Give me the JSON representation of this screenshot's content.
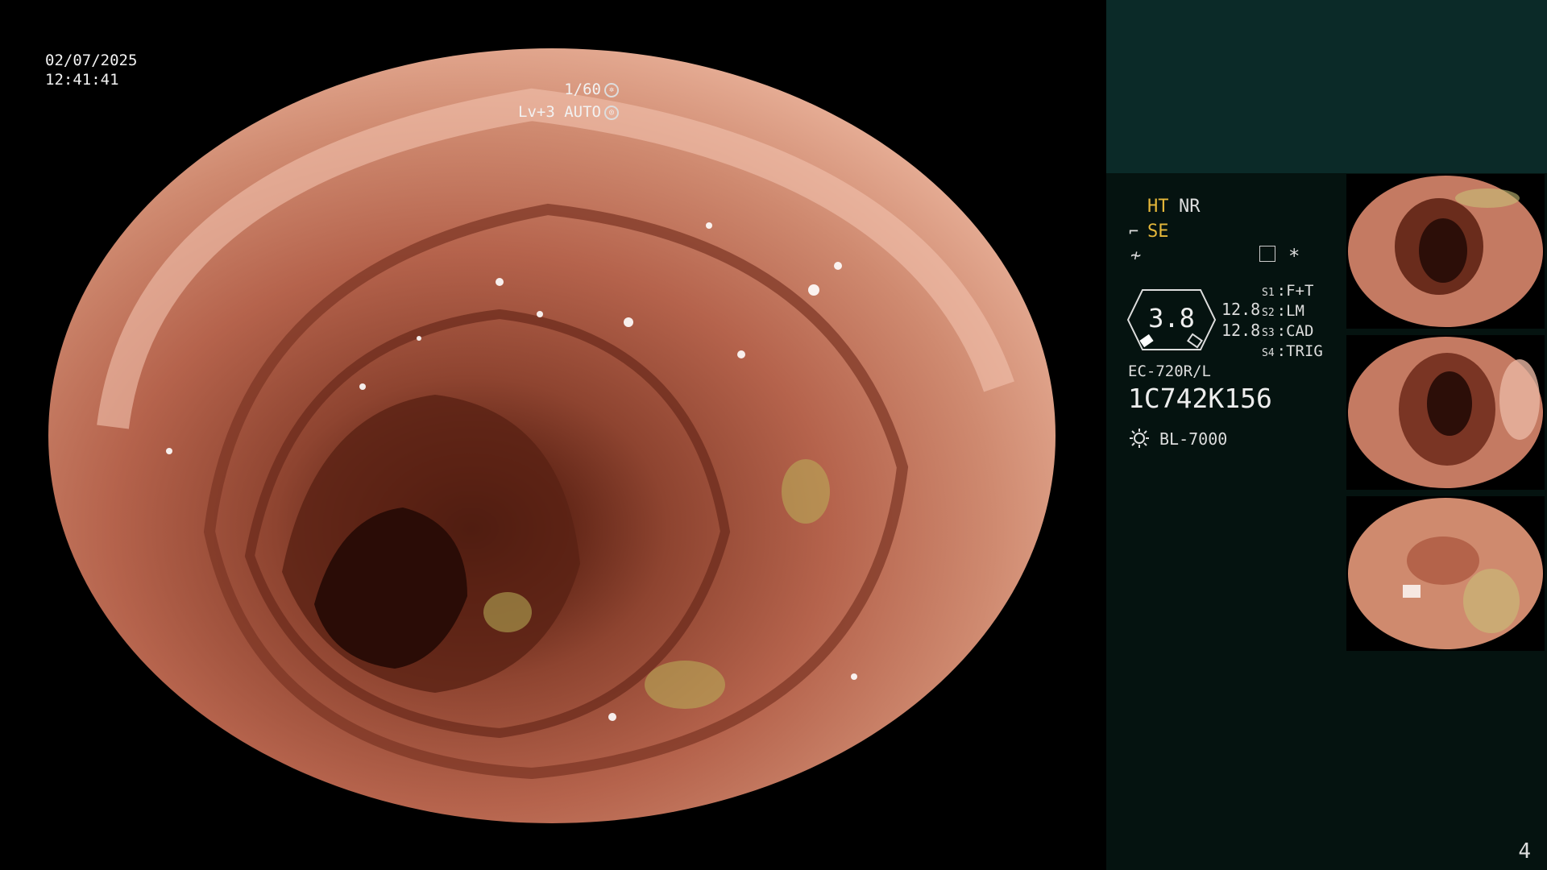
{
  "overlay": {
    "date": "02/07/2025",
    "time": "12:41:41",
    "shutter": "1/60",
    "level": "Lv+3 AUTO"
  },
  "panel": {
    "ht": "HT",
    "nr": "NR",
    "se": "SE",
    "star": "*",
    "gauge_value": "3.8",
    "gauge_side_1": "12.8",
    "gauge_side_2": "12.8",
    "switches": [
      {
        "key": "S1",
        "value": "F+T"
      },
      {
        "key": "S2",
        "value": "LM"
      },
      {
        "key": "S3",
        "value": "CAD"
      },
      {
        "key": "S4",
        "value": "TRIG"
      }
    ],
    "model": "EC-720R/L",
    "serial": "1C742K156",
    "light_source": "BL-7000",
    "page_number": "4"
  },
  "colors": {
    "status_accent": "#e6b83a",
    "panel_bg": "#051310",
    "panel_top_bg": "#0b2a28",
    "tissue": "#c98068"
  },
  "icons": [
    "shutter-icon",
    "auto-iris-icon",
    "structure-enhance-icon",
    "freeze-icon",
    "menu-icon",
    "light-source-icon"
  ]
}
